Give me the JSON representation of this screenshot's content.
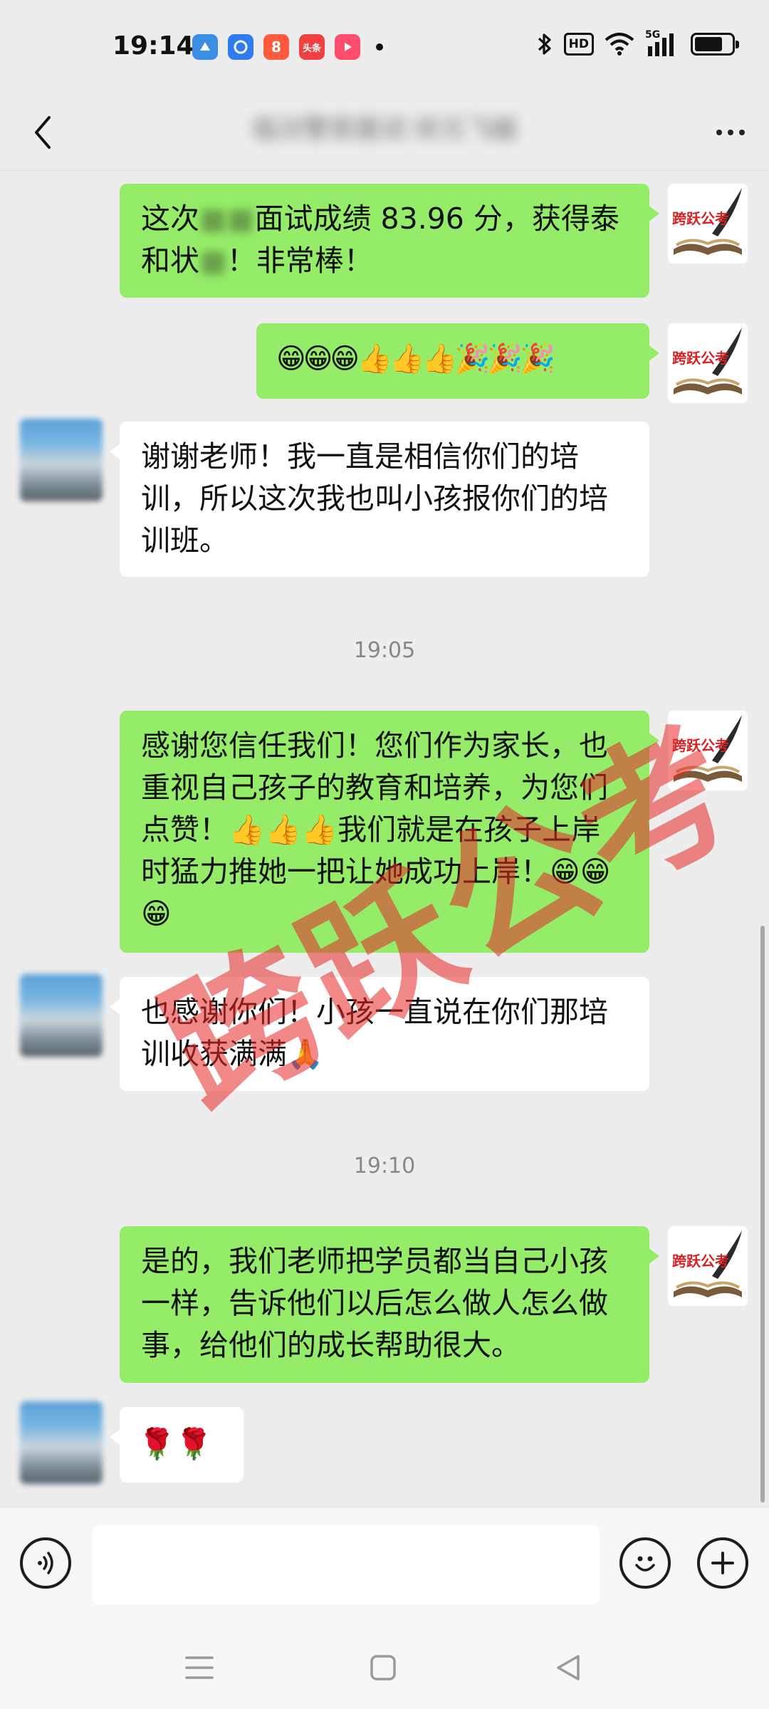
{
  "status_bar": {
    "time": "19:14",
    "apps": [
      {
        "name": "blue-app",
        "label": "",
        "color": "#3a8ee6"
      },
      {
        "name": "browser-app",
        "label": "",
        "color": "#2f7bf0"
      },
      {
        "name": "shopping-app",
        "label": "8",
        "color": "#ff5a3c"
      },
      {
        "name": "toutiao-app",
        "label": "头条",
        "color": "#f04141"
      },
      {
        "name": "video-app",
        "label": "",
        "color": "#ff4d6d"
      }
    ],
    "hd_label": "HD",
    "network_label": "5G",
    "battery_level": 0.75
  },
  "nav": {
    "title": "临汾警官面试·状元飞越"
  },
  "messages": [
    {
      "dir": "out",
      "parts": [
        "这次",
        "",
        "面试成绩 83.96 分，获得泰和状",
        "",
        "！非常棒！"
      ]
    },
    {
      "dir": "out",
      "text": "😁😁😁👍👍👍🎉🎉🎉"
    },
    {
      "dir": "in",
      "text": "谢谢老师！我一直是相信你们的培训，所以这次我也叫小孩报你们的培训班。"
    },
    {
      "dir": "time",
      "text": "19:05"
    },
    {
      "dir": "out",
      "text": "感谢您信任我们！您们作为家长，也重视自己孩子的教育和培养，为您们点赞！👍👍👍我们就是在孩子上岸时猛力推她一把让她成功上岸！😁😁😁"
    },
    {
      "dir": "in",
      "text": "也感谢你们！小孩一直说在你们那培训收获满满🙏"
    },
    {
      "dir": "time",
      "text": "19:10"
    },
    {
      "dir": "out",
      "text": "是的，我们老师把学员都当自己小孩一样，告诉他们以后怎么做人怎么做事，给他们的成长帮助很大。"
    },
    {
      "dir": "in",
      "text": "🌹🌹"
    }
  ],
  "self_avatar_text": "跨跃公考",
  "watermark": "跨跃公考",
  "colors": {
    "bubble_out": "#95ec69",
    "bubble_in": "#ffffff",
    "background": "#ededed"
  }
}
